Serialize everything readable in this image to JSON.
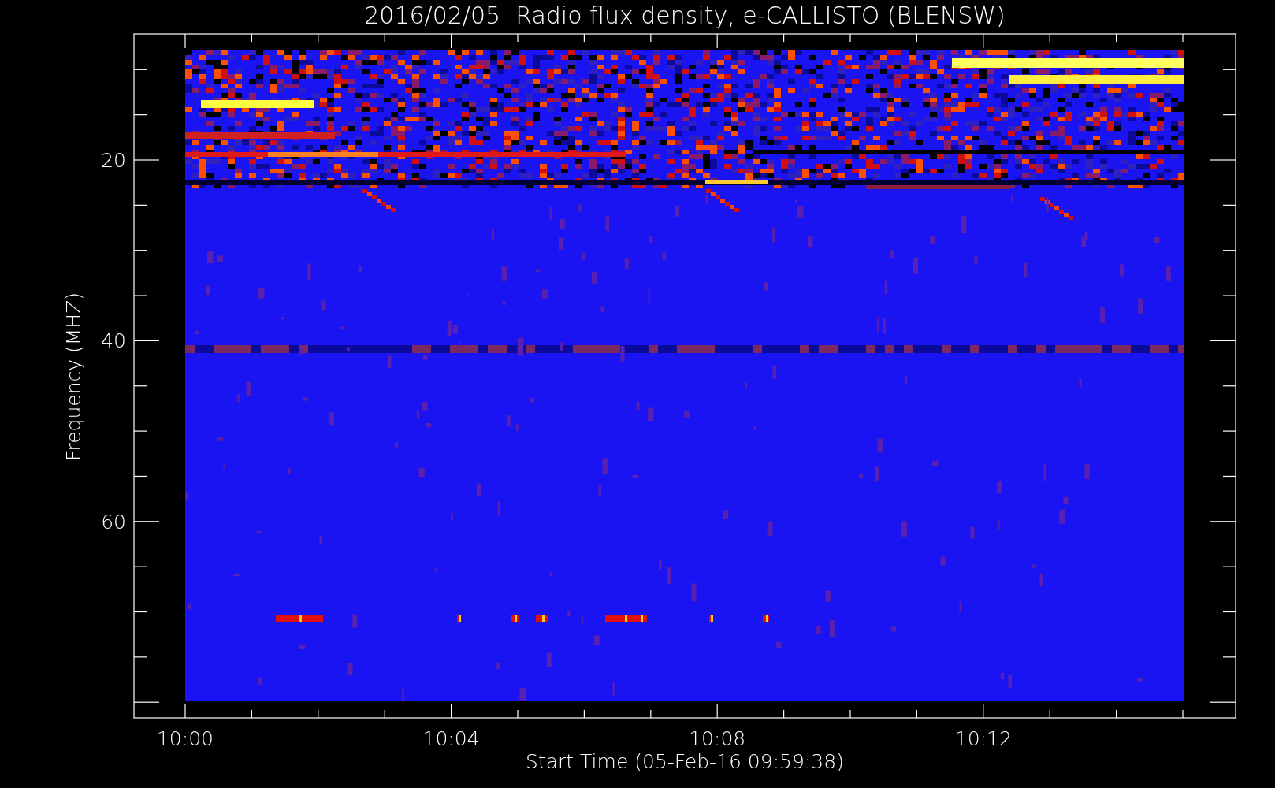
{
  "title": "2016/02/05  Radio flux density, e-CALLISTO (BLENSW)",
  "plot": {
    "xlabel": "Start Time (05-Feb-16 09:59:38)",
    "ylabel": "Frequency (MHZ)",
    "x_tick_labels": [
      "10:00",
      "10:04",
      "10:08",
      "10:12"
    ],
    "y_tick_labels": [
      "20",
      "40",
      "60"
    ]
  }
}
